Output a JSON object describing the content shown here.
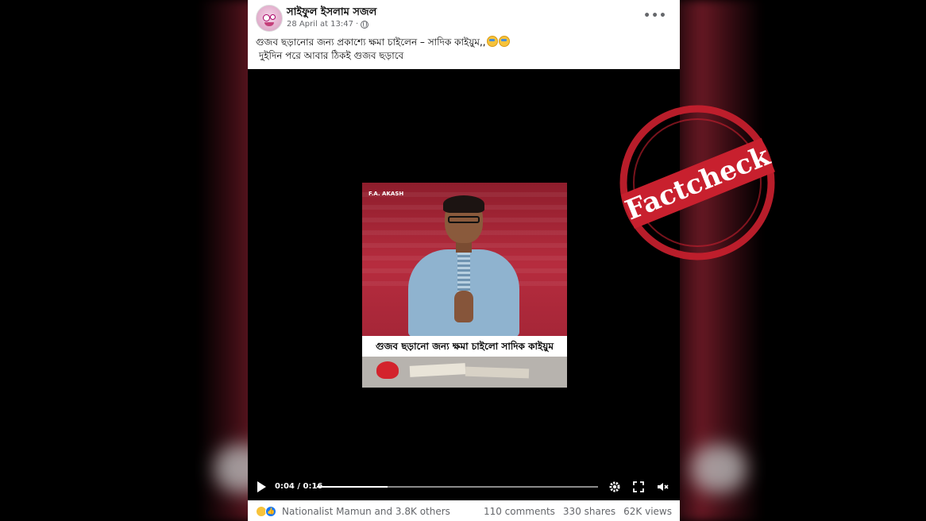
{
  "post": {
    "author": "সাইফুল ইসলাম সজল",
    "timestamp": "28 April at 13:47",
    "privacy_separator": "·",
    "more_label": "•••",
    "caption_line1": "গুজব ছড়ানোর জন্য প্রকাশ্যে ক্ষমা চাইলেন – সাদিক কাইয়ুম,,",
    "caption_line2": "দুইদিন পরে আবার ঠিকই গুজব ছড়াবে",
    "caption_emojis": [
      "nerd-face-emoji",
      "nerd-face-emoji"
    ]
  },
  "video": {
    "thumbnail_watermark": "F.A. AKASH",
    "subtitle": "গুজব ছড়ানো জন্য ক্ষমা চাইলো সাদিক কাইয়ুম",
    "time": "0:04 / 0:16",
    "progress": 0.25,
    "icons": [
      "play-icon",
      "gear-icon",
      "fullscreen-icon",
      "muted-speaker-icon"
    ]
  },
  "footer": {
    "reactions_text": "Nationalist Mamun and 3.8K others",
    "comments": "110 comments",
    "shares": "330 shares",
    "views": "62K views",
    "reaction_icons": [
      "haha-icon",
      "like-icon"
    ]
  },
  "stamp": {
    "text": "Factcheck",
    "color": "#c8202e"
  },
  "colors": {
    "text_primary": "#050505",
    "text_secondary": "#65676b",
    "like_blue": "#1877f2"
  }
}
